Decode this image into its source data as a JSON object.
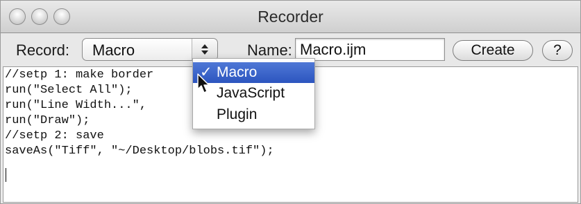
{
  "window": {
    "title": "Recorder"
  },
  "toolbar": {
    "record_label": "Record:",
    "record_value": "Macro",
    "name_label": "Name:",
    "name_value": "Macro.ijm",
    "create_label": "Create",
    "help_label": "?"
  },
  "editor": {
    "code": "//setp 1: make border\nrun(\"Select All\");\nrun(\"Line Width...\",\nrun(\"Draw\");\n//setp 2: save\nsaveAs(\"Tiff\", \"~/Desktop/blobs.tif\");"
  },
  "dropdown": {
    "check_mark": "✓",
    "options": [
      {
        "label": "Macro",
        "selected": true
      },
      {
        "label": "JavaScript",
        "selected": false
      },
      {
        "label": "Plugin",
        "selected": false
      }
    ]
  },
  "colors": {
    "selection": "#3762c8",
    "window_bg": "#ebebeb"
  },
  "icons": {
    "cursor": "arrow-pointer-icon",
    "stepper": "up-down-arrows-icon"
  }
}
